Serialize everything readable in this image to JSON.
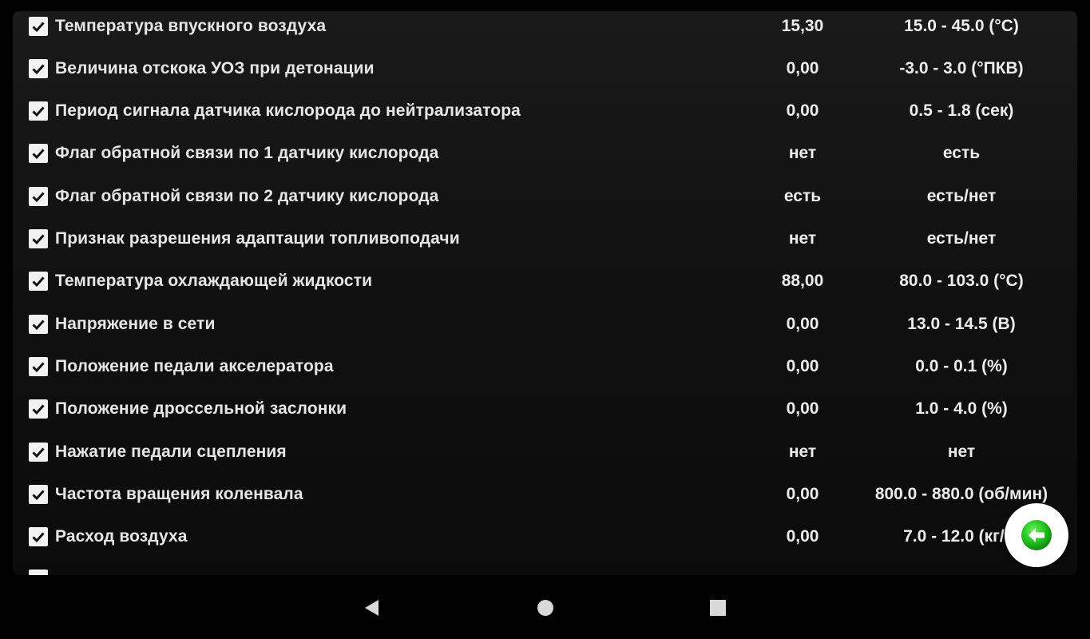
{
  "rows": [
    {
      "name": "Температура впускного воздуха",
      "value": "15,30",
      "range": "15.0 - 45.0 (°C)"
    },
    {
      "name": "Величина отскока УОЗ при детонации",
      "value": "0,00",
      "range": "-3.0 - 3.0 (°ПКВ)"
    },
    {
      "name": "Период сигнала датчика кислорода до нейтрализатора",
      "value": "0,00",
      "range": "0.5 - 1.8 (сек)"
    },
    {
      "name": "Флаг обратной связи по 1 датчику кислорода",
      "value": "нет",
      "range": "есть"
    },
    {
      "name": "Флаг обратной связи по 2 датчику кислорода",
      "value": "есть",
      "range": "есть/нет"
    },
    {
      "name": "Признак разрешения адаптации топливоподачи",
      "value": "нет",
      "range": "есть/нет"
    },
    {
      "name": "Температура охлаждающей жидкости",
      "value": "88,00",
      "range": "80.0 - 103.0 (°C)"
    },
    {
      "name": "Напряжение в сети",
      "value": "0,00",
      "range": "13.0 - 14.5 (В)"
    },
    {
      "name": "Положение педали акселератора",
      "value": "0,00",
      "range": "0.0 - 0.1 (%)"
    },
    {
      "name": "Положение дроссельной заслонки",
      "value": "0,00",
      "range": "1.0 - 4.0 (%)"
    },
    {
      "name": "Нажатие педали сцепления",
      "value": "нет",
      "range": "нет"
    },
    {
      "name": "Частота вращения коленвала",
      "value": "0,00",
      "range": "800.0 - 880.0 (об/мин)"
    },
    {
      "name": "Расход воздуха",
      "value": "0,00",
      "range": "7.0 - 12.0 (кг/ч)"
    }
  ],
  "fab": {
    "icon": "arrow-left-icon",
    "color": "#22c21f"
  },
  "nav": {
    "back_icon": "triangle-back-icon",
    "home_icon": "circle-home-icon",
    "recents_icon": "square-recents-icon"
  },
  "colors": {
    "background": "#000000",
    "panel": "#141414",
    "text": "#e6e6e6",
    "accent": "#22c21f"
  }
}
